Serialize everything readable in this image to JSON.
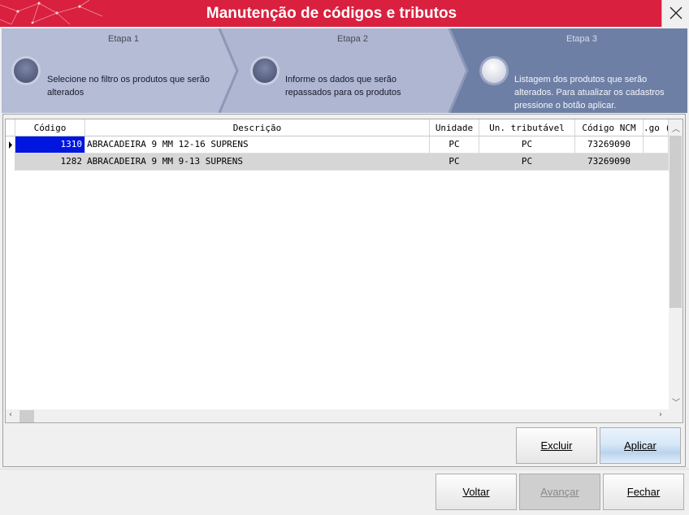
{
  "window": {
    "title": "Manutenção de códigos e tributos",
    "close_icon": "close-icon"
  },
  "steps": [
    {
      "title": "Etapa 1",
      "desc_lines": [
        "Selecione no filtro os produtos que serão",
        "alterados"
      ]
    },
    {
      "title": "Etapa 2",
      "desc_lines": [
        "Informe os dados que serão",
        "repassados para os produtos"
      ]
    },
    {
      "title": "Etapa 3",
      "desc_lines": [
        "Listagem dos produtos que serão",
        "alterados. Para atualizar os cadastros",
        "pressione o botão aplicar."
      ]
    }
  ],
  "grid": {
    "columns": [
      "Código",
      "Descrição",
      "Unidade",
      "Un. tributável",
      "Código NCM",
      ".go ("
    ],
    "rows": [
      {
        "codigo": "1310",
        "descricao": "ABRACADEIRA 9 MM 12-16 SUPRENS",
        "unidade": "PC",
        "un_tributavel": "PC",
        "ncm": "73269090"
      },
      {
        "codigo": "1282",
        "descricao": "ABRACADEIRA 9 MM 9-13 SUPRENS",
        "unidade": "PC",
        "un_tributavel": "PC",
        "ncm": "73269090"
      }
    ]
  },
  "actions": {
    "excluir": "Excluir",
    "aplicar": "Aplicar"
  },
  "nav": {
    "voltar": "Voltar",
    "avancar": "Avançar",
    "fechar": "Fechar"
  },
  "colors": {
    "title_bar": "#d9203f",
    "step_inactive": "#b4bcd6",
    "step_active": "#6e7fa6",
    "selection": "#0016e0"
  }
}
